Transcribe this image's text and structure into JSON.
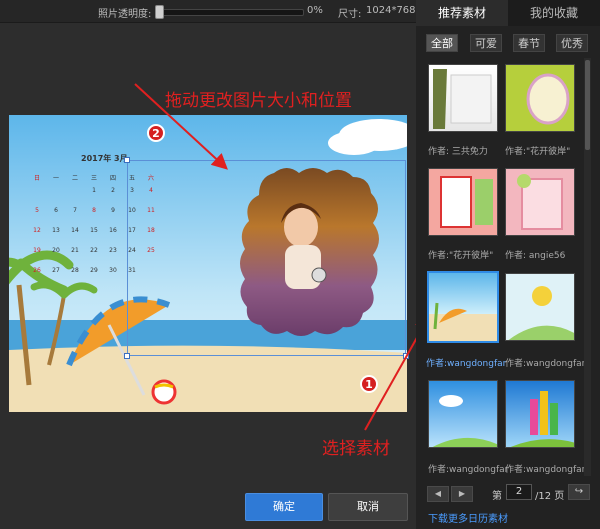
{
  "topbar": {
    "opacity_label": "照片透明度:",
    "opacity_value": "0%",
    "size_label": "尺寸:",
    "size_value": "1024*768"
  },
  "canvas": {
    "calendar_month": "2017年  3月",
    "weekdays": [
      "日",
      "一",
      "二",
      "三",
      "四",
      "五",
      "六"
    ],
    "rows": [
      [
        "",
        "",
        "",
        "1",
        "2",
        "3",
        "4"
      ],
      [
        "5",
        "6",
        "7",
        "8",
        "9",
        "10",
        "11"
      ],
      [
        "12",
        "13",
        "14",
        "15",
        "16",
        "17",
        "18"
      ],
      [
        "19",
        "20",
        "21",
        "22",
        "23",
        "24",
        "25"
      ],
      [
        "26",
        "27",
        "28",
        "29",
        "30",
        "31",
        ""
      ]
    ]
  },
  "annotations": {
    "drag_hint": "拖动更改图片大小和位置",
    "select_hint": "选择素材",
    "badge1": "1",
    "badge2": "2"
  },
  "buttons": {
    "confirm": "确定",
    "cancel": "取消"
  },
  "panel": {
    "tabs": [
      "推荐素材",
      "我的收藏"
    ],
    "subtabs": [
      "全部",
      "可爱",
      "春节",
      "优秀"
    ],
    "authors": [
      "作者: 三共免力",
      "作者:\"花开彼岸\"",
      "作者:\"花开彼岸\"",
      "作者: angie56",
      "作者:wangdongfang",
      "作者:wangdongfang",
      "作者:wangdongfang",
      "作者:wangdongfang"
    ],
    "pager": {
      "prefix": "第",
      "page": "2",
      "suffix": "/12 页"
    },
    "download_link": "下载更多日历素材"
  }
}
